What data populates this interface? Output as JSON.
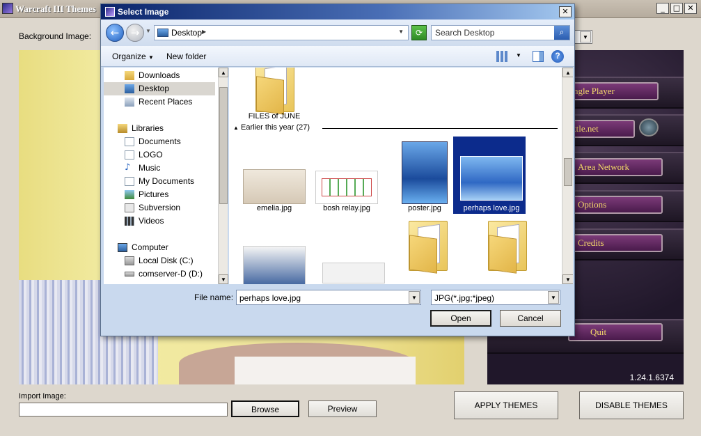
{
  "app": {
    "title": "Warcraft III Themes",
    "background_label": "Background Image:",
    "import_label": "Import Image:",
    "import_value": "",
    "browse_label": "Browse",
    "preview_label": "Preview",
    "apply_label": "APPLY THEMES",
    "disable_label": "DISABLE THEMES",
    "menu": {
      "single_player": "ngle Player",
      "battle_net": "ttle.net",
      "area_network": "Area Network",
      "options": "Options",
      "credits": "Credits",
      "quit": "Quit"
    },
    "version": "1.24.1.6374"
  },
  "dialog": {
    "title": "Select Image",
    "address": "Desktop",
    "search_placeholder": "Search Desktop",
    "toolbar": {
      "organize": "Organize",
      "new_folder": "New folder"
    },
    "nav": [
      {
        "label": "Downloads",
        "icon": "downloads-folder-icon"
      },
      {
        "label": "Desktop",
        "icon": "desktop-icon"
      },
      {
        "label": "Recent Places",
        "icon": "recent-places-icon"
      },
      {
        "label": "Libraries",
        "icon": "libraries-icon"
      },
      {
        "label": "Documents",
        "icon": "documents-icon"
      },
      {
        "label": "LOGO",
        "icon": "document-icon"
      },
      {
        "label": "Music",
        "icon": "music-icon"
      },
      {
        "label": "My Documents",
        "icon": "documents-icon"
      },
      {
        "label": "Pictures",
        "icon": "pictures-icon"
      },
      {
        "label": "Subversion",
        "icon": "subversion-icon"
      },
      {
        "label": "Videos",
        "icon": "videos-icon"
      },
      {
        "label": "Computer",
        "icon": "computer-icon"
      },
      {
        "label": "Local Disk (C:)",
        "icon": "local-disk-icon"
      },
      {
        "label": "comserver-D (D:)",
        "icon": "network-drive-icon"
      }
    ],
    "group_header": "Earlier this year (27)",
    "files": [
      {
        "name": "FILES of JUNE",
        "type": "folder"
      },
      {
        "name": "emelia.jpg",
        "type": "image"
      },
      {
        "name": "bosh relay.jpg",
        "type": "image"
      },
      {
        "name": "poster.jpg",
        "type": "image"
      },
      {
        "name": "perhaps love.jpg",
        "type": "image",
        "selected": true
      }
    ],
    "file_name_label": "File name:",
    "file_name_value": "perhaps love.jpg",
    "filter_value": "JPG(*.jpg;*jpeg)",
    "open_label": "Open",
    "cancel_label": "Cancel"
  }
}
